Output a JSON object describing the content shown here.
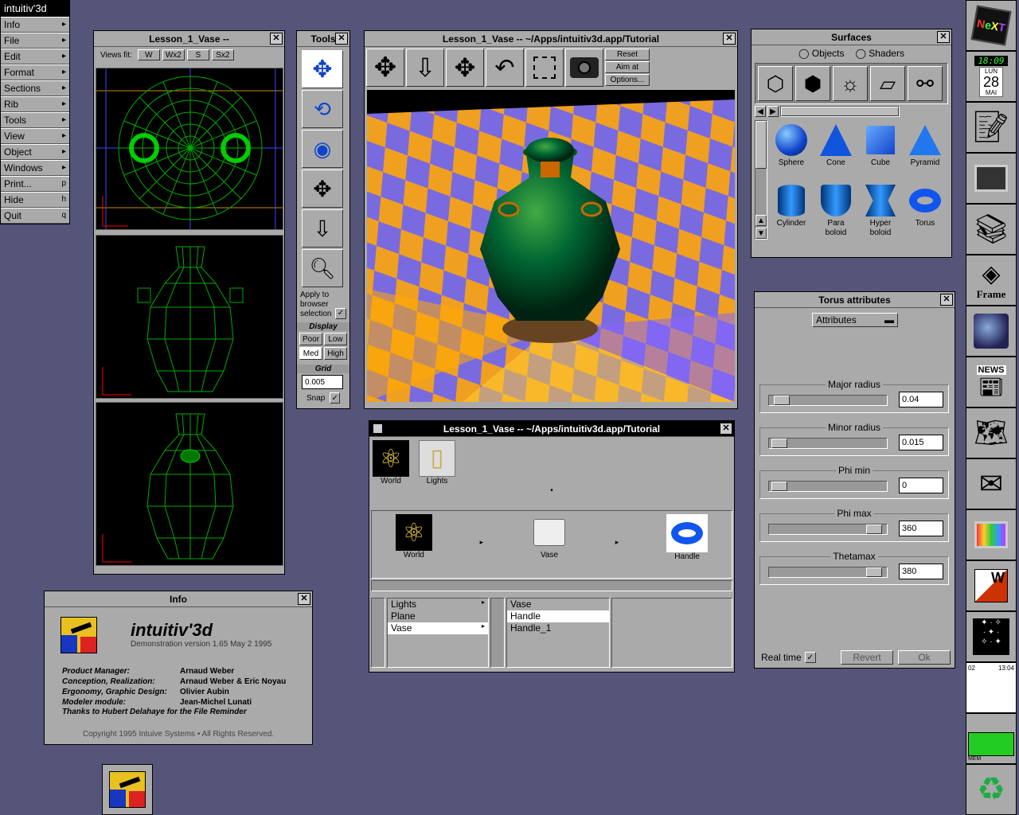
{
  "menu": {
    "title": "intuitiv'3d",
    "items": [
      {
        "label": "Info",
        "key": "▸"
      },
      {
        "label": "File",
        "key": "▸"
      },
      {
        "label": "Edit",
        "key": "▸"
      },
      {
        "label": "Format",
        "key": "▸"
      },
      {
        "label": "Sections",
        "key": "▸"
      },
      {
        "label": "Rib",
        "key": "▸"
      },
      {
        "label": "Tools",
        "key": "▸"
      },
      {
        "label": "View",
        "key": "▸"
      },
      {
        "label": "Object",
        "key": "▸"
      },
      {
        "label": "Windows",
        "key": "▸"
      },
      {
        "label": "Print...",
        "key": "p"
      },
      {
        "label": "Hide",
        "key": "h"
      },
      {
        "label": "Quit",
        "key": "q"
      }
    ]
  },
  "ortho": {
    "title": "Lesson_1_Vase --",
    "views_fit": "Views fit:",
    "fit_buttons": [
      "W",
      "Wx2",
      "S",
      "Sx2"
    ]
  },
  "tools": {
    "title": "Tools",
    "apply_label": "Apply to browser selection",
    "display_label": "Display",
    "display_options": [
      "Poor",
      "Low",
      "Med",
      "High"
    ],
    "grid_label": "Grid",
    "grid_value": "0.005",
    "snap_label": "Snap"
  },
  "camera": {
    "title": "Lesson_1_Vase -- ~/Apps/intuitiv3d.app/Tutorial",
    "reset": "Reset",
    "aim": "Aim at",
    "options": "Options..."
  },
  "surfaces": {
    "title": "Surfaces",
    "radio_objects": "Objects",
    "radio_shaders": "Shaders",
    "items": [
      {
        "label": "Sphere"
      },
      {
        "label": "Cone"
      },
      {
        "label": "Cube"
      },
      {
        "label": "Pyramid"
      },
      {
        "label": "Cylinder"
      },
      {
        "label": "Para\nboloid"
      },
      {
        "label": "Hyper\nboloid"
      },
      {
        "label": "Torus"
      }
    ]
  },
  "torus": {
    "title": "Torus attributes",
    "popup": "Attributes",
    "params": [
      {
        "label": "Major radius",
        "value": "0.04",
        "pos": 0.05
      },
      {
        "label": "Minor radius",
        "value": "0.015",
        "pos": 0.02
      },
      {
        "label": "Phi min",
        "value": "0",
        "pos": 0.02
      },
      {
        "label": "Phi max",
        "value": "360",
        "pos": 0.95
      },
      {
        "label": "Thetamax",
        "value": "380",
        "pos": 0.95
      }
    ],
    "realtime": "Real time",
    "revert": "Revert",
    "ok": "Ok"
  },
  "browser": {
    "title": "Lesson_1_Vase -- ~/Apps/intuitiv3d.app/Tutorial",
    "top_icons": [
      "World",
      "Lights"
    ],
    "path_icons": [
      "World",
      "Vase",
      "Handle"
    ],
    "col1": [
      "Lights",
      "Plane",
      "Vase"
    ],
    "col2": [
      "Vase",
      "Handle",
      "Handle_1"
    ]
  },
  "info": {
    "title": "Info",
    "app": "intuitiv'3d",
    "version": "Demonstration version 1.65 May 2 1995",
    "credits": [
      {
        "role": "Product Manager:",
        "name": "Arnaud Weber"
      },
      {
        "role": "Conception, Realization:",
        "name": "Arnaud Weber & Eric Noyau"
      },
      {
        "role": "Ergonomy, Graphic Design:",
        "name": "Olivier Aubin"
      },
      {
        "role": "Modeler module:",
        "name": "Jean-Michel Lunati"
      }
    ],
    "thanks": "Thanks to Hubert Delahaye for the File Reminder",
    "copyright": "Copyright 1995  Intuive Systems • All Rights Reserved."
  },
  "dock": {
    "clock": "18:09",
    "day": "LUN",
    "date": "28",
    "month": "MAI",
    "frame": "Frame",
    "news": "NEWS",
    "mem": "MEM",
    "cpu_times": [
      "02",
      "13:04"
    ]
  }
}
